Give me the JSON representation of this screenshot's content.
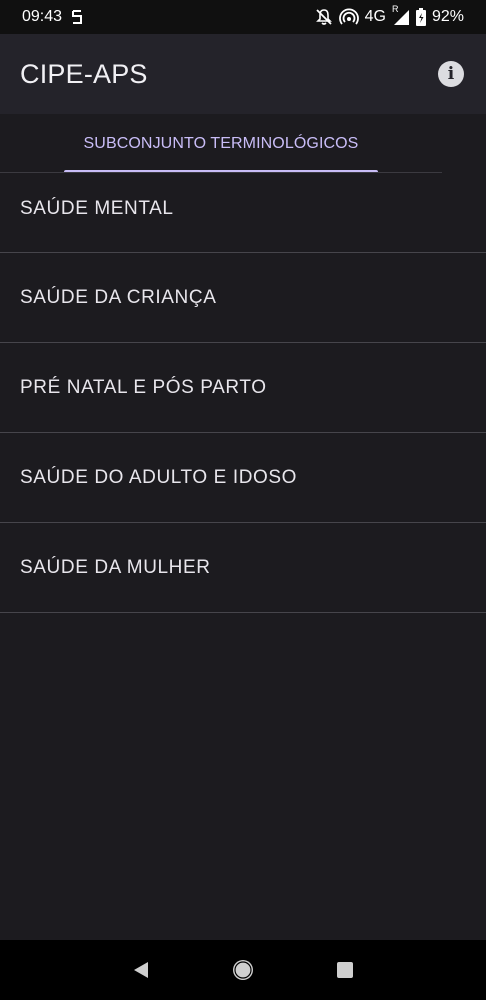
{
  "status_bar": {
    "time": "09:43",
    "network": "4G",
    "roaming": "R",
    "battery": "92%"
  },
  "app_bar": {
    "title": "CIPE-APS",
    "info_icon": "info-icon"
  },
  "tabs": [
    {
      "label": "SUBCONJUNTO TERMINOLÓGICOS",
      "selected": true
    }
  ],
  "colors": {
    "accent": "#c9bdf7",
    "background": "#1c1b1f",
    "app_bar": "#24232a"
  },
  "list": {
    "items": [
      {
        "label": "SAÚDE MENTAL"
      },
      {
        "label": "SAÚDE DA CRIANÇA"
      },
      {
        "label": "PRÉ NATAL E PÓS PARTO"
      },
      {
        "label": "SAÚDE DO ADULTO E IDOSO"
      },
      {
        "label": "SAÚDE DA MULHER"
      }
    ]
  },
  "nav_bar": {
    "back": "back-icon",
    "home": "home-icon",
    "recents": "recents-icon"
  }
}
